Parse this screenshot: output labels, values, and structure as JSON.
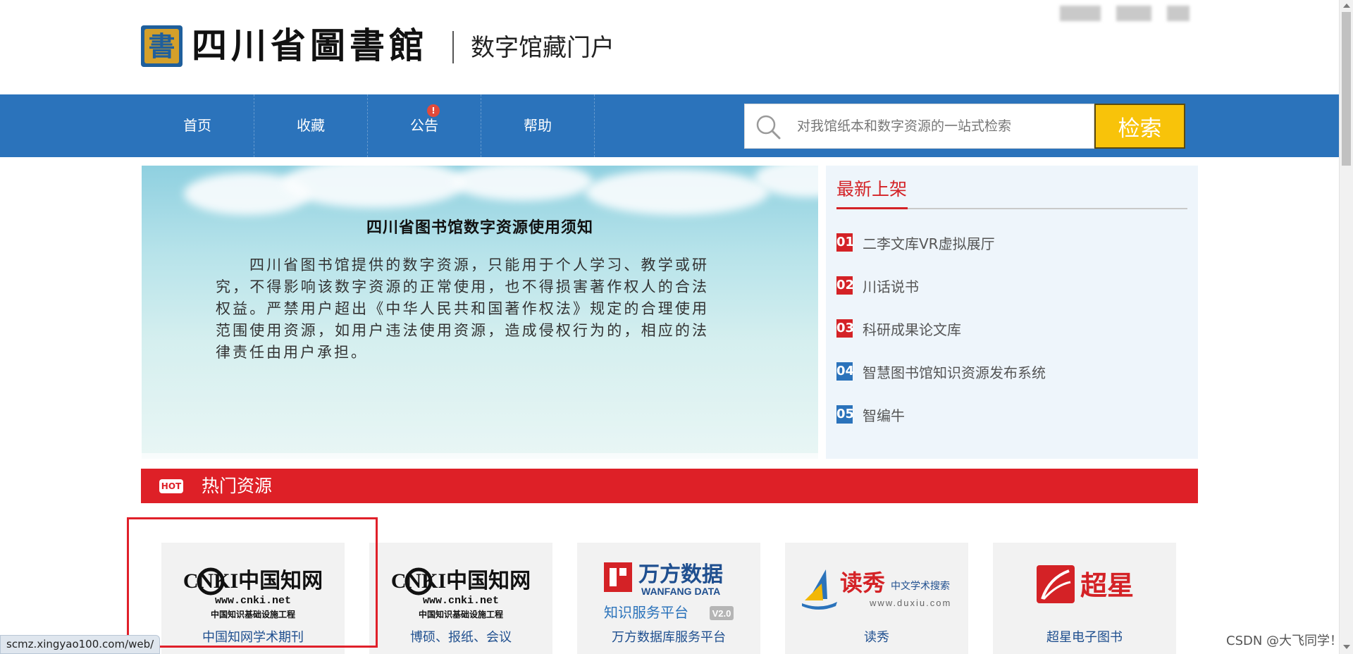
{
  "header": {
    "logo_glyph": "書",
    "logo_text": "四川省圖書館",
    "portal_title": "数字馆藏门户"
  },
  "nav": {
    "items": [
      {
        "label": "首页"
      },
      {
        "label": "收藏"
      },
      {
        "label": "公告",
        "badge": "!"
      },
      {
        "label": "帮助"
      }
    ]
  },
  "search": {
    "placeholder": "对我馆纸本和数字资源的一站式检索",
    "button_label": "检索"
  },
  "banner": {
    "title": "四川省图书馆数字资源使用须知",
    "text": "四川省图书馆提供的数字资源，只能用于个人学习、教学或研究，不得影响该数字资源的正常使用，也不得损害著作权人的合法权益。严禁用户超出《中华人民共和国著作权法》规定的合理使用范围使用资源，如用户违法使用资源，造成侵权行为的，相应的法律责任由用户承担。"
  },
  "latest": {
    "title": "最新上架",
    "items": [
      {
        "num": "01",
        "label": "二李文库VR虚拟展厅",
        "color": "#d42226"
      },
      {
        "num": "02",
        "label": "川话说书",
        "color": "#d42226"
      },
      {
        "num": "03",
        "label": "科研成果论文库",
        "color": "#d42226"
      },
      {
        "num": "04",
        "label": "智慧图书馆知识资源发布系统",
        "color": "#2b73bb"
      },
      {
        "num": "05",
        "label": "智编牛",
        "color": "#2b73bb"
      }
    ]
  },
  "hot": {
    "tag": "HOT",
    "title": "热门资源"
  },
  "resources": [
    {
      "label": "中国知网学术期刊",
      "logo": "cnki",
      "logo_main": "CNKI中国知网",
      "logo_url": "www.cnki.net",
      "logo_sub": "中国知识基础设施工程"
    },
    {
      "label": "博硕、报纸、会议",
      "logo": "cnki",
      "logo_main": "CNKI中国知网",
      "logo_url": "www.cnki.net",
      "logo_sub": "中国知识基础设施工程"
    },
    {
      "label": "万方数据库服务平台",
      "logo": "wanfang",
      "logo_main": "万方数据",
      "logo_en": "WANFANG DATA",
      "logo_sub": "知识服务平台",
      "logo_ver": "V2.0"
    },
    {
      "label": "读秀",
      "logo": "duxiu",
      "logo_main": "读秀",
      "logo_sub": "中文学术搜索",
      "logo_url": "www.duxiu.com"
    },
    {
      "label": "超星电子图书",
      "logo": "chaoxing",
      "logo_main": "超星"
    }
  ],
  "status_url": "scmz.xingyao100.com/web/",
  "watermark": "CSDN @大飞同学！",
  "colors": {
    "nav_blue": "#2b73bb",
    "hot_red": "#de2027",
    "search_yellow": "#f8c30a",
    "link_blue": "#1f4f8f"
  }
}
